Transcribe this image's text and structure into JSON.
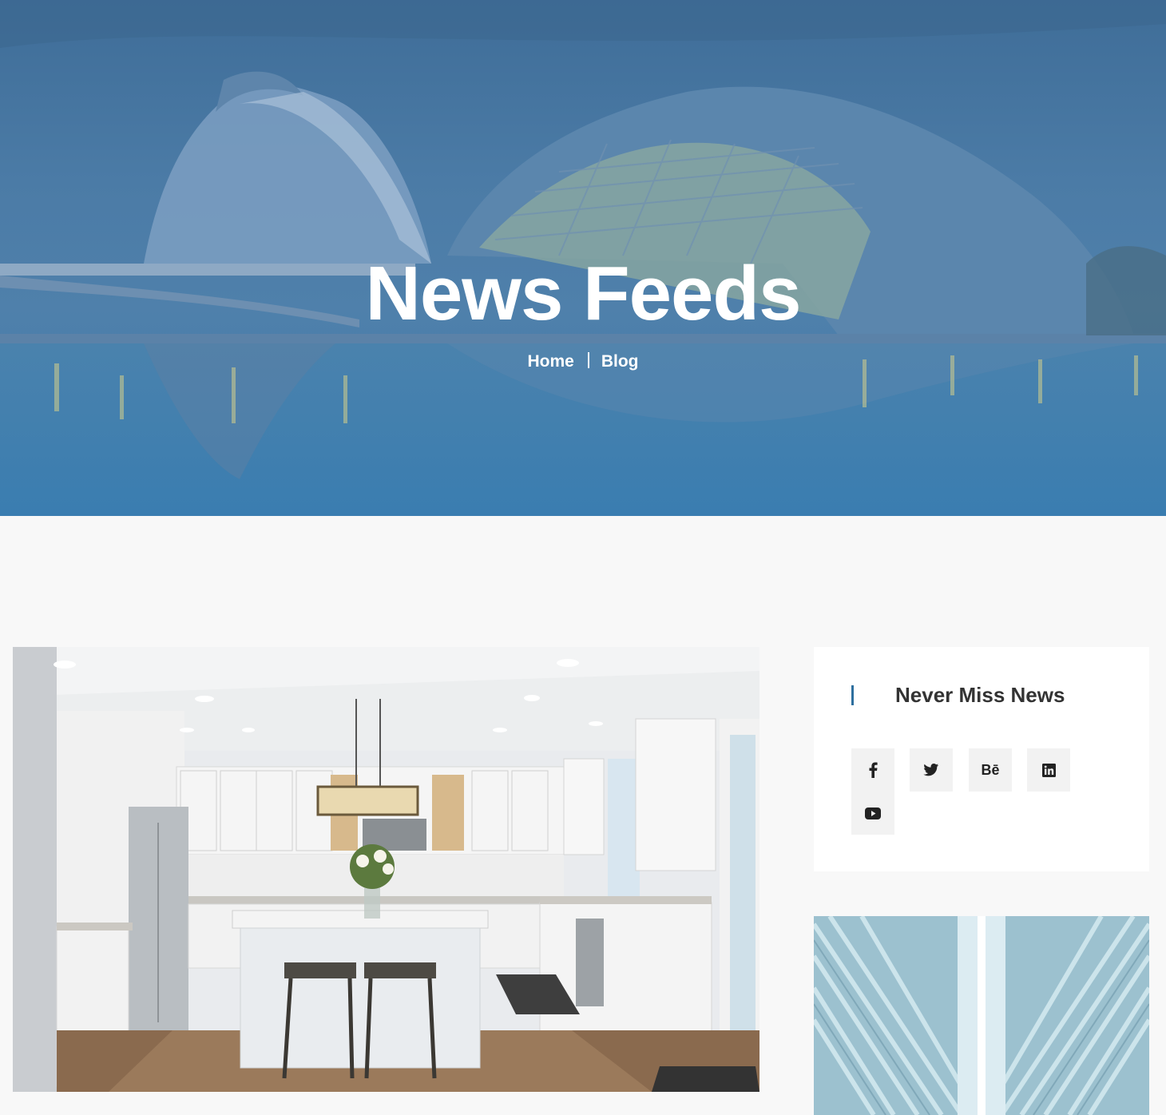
{
  "hero": {
    "title": "News Feeds",
    "breadcrumb": {
      "home": "Home",
      "current": "Blog"
    },
    "overlay_color": "#3f6d98"
  },
  "post": {
    "image_alt": "kitchen-photo"
  },
  "sidebar": {
    "widget_title": "Never Miss News",
    "accent_color": "#2e6f9e",
    "social": [
      {
        "icon": "facebook-icon",
        "glyph": "f"
      },
      {
        "icon": "twitter-icon",
        "glyph": ""
      },
      {
        "icon": "behance-icon",
        "glyph": "Bē"
      },
      {
        "icon": "linkedin-icon",
        "glyph": "in"
      },
      {
        "icon": "youtube-icon",
        "glyph": ""
      }
    ]
  }
}
